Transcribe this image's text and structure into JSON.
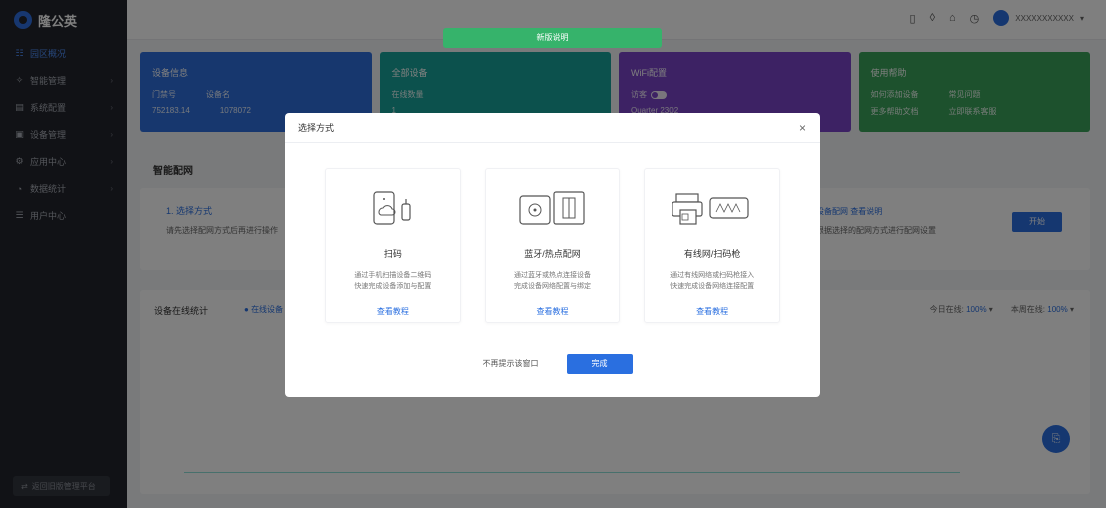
{
  "app": {
    "logo_text": "隆公英"
  },
  "sidebar": {
    "items": [
      {
        "label": "园区概况",
        "icon": "grid-icon",
        "active": true
      },
      {
        "label": "智能管理",
        "icon": "settings-icon",
        "active": false,
        "has_children": true
      },
      {
        "label": "系统配置",
        "icon": "doc-icon",
        "active": false,
        "has_children": true
      },
      {
        "label": "设备管理",
        "icon": "device-icon",
        "active": false,
        "has_children": true
      },
      {
        "label": "应用中心",
        "icon": "app-icon",
        "active": false,
        "has_children": true
      },
      {
        "label": "数据统计",
        "icon": "chart-icon",
        "active": false,
        "has_children": true
      },
      {
        "label": "用户中心",
        "icon": "user-icon",
        "active": false
      }
    ],
    "footer_label": "返回旧版管理平台"
  },
  "topbar": {
    "banner": "新版说明",
    "user_label": "XXXXXXXXXXX"
  },
  "cards": [
    {
      "title": "设备信息",
      "rows": [
        [
          "门禁号",
          "设备名"
        ],
        [
          "752183.14",
          "1078072"
        ]
      ]
    },
    {
      "title": "全部设备",
      "rows": [
        [
          "在线数量"
        ],
        [
          "1"
        ]
      ]
    },
    {
      "title": "WiFi配置",
      "rows": [
        [
          "访客"
        ],
        [
          "Quarter 2302"
        ]
      ]
    },
    {
      "title": "使用帮助",
      "rows": [
        [
          "如何添加设备",
          "常见问题"
        ],
        [
          "更多帮助文档",
          "立即联系客服"
        ]
      ]
    }
  ],
  "section": {
    "title": "智能配网"
  },
  "steps": {
    "left_title": "1. 选择方式",
    "left_sub": "请先选择配网方式后再进行操作",
    "right_title": "设备配网 查看说明",
    "right_sub": "根据选择的配网方式进行配网设置",
    "button": "开始"
  },
  "chart_panel": {
    "title": "设备在线统计",
    "legend": "在线设备",
    "total_label_1": "今日在线:",
    "total_value_1": "100%",
    "total_label_2": "本周在线:",
    "total_value_2": "100%"
  },
  "modal": {
    "title": "选择方式",
    "close": "×",
    "methods": [
      {
        "name": "扫码",
        "desc_1": "通过手机扫描设备二维码",
        "desc_2": "快速完成设备添加与配置",
        "link": "查看教程",
        "icon": "scan-device-icon"
      },
      {
        "name": "蓝牙/热点配网",
        "desc_1": "通过蓝牙或热点连接设备",
        "desc_2": "完成设备网络配置与绑定",
        "link": "查看教程",
        "icon": "bluetooth-device-icon"
      },
      {
        "name": "有线网/扫码枪",
        "desc_1": "通过有线网络或扫码枪接入",
        "desc_2": "快速完成设备网络连接配置",
        "link": "查看教程",
        "icon": "wired-printer-icon"
      }
    ],
    "cancel": "不再提示该窗口",
    "ok": "完成"
  }
}
